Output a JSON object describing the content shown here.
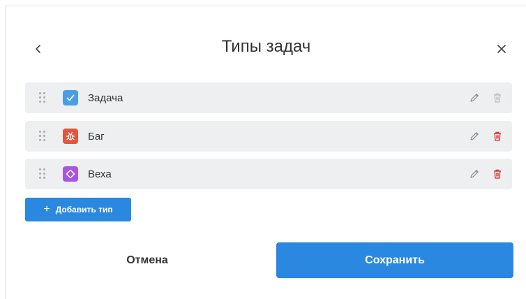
{
  "dialog": {
    "title": "Типы задач",
    "back_icon": "chevron-left-icon",
    "close_icon": "close-icon"
  },
  "types": [
    {
      "label": "Задача",
      "icon": "checkmark-icon",
      "icon_color": "#4a9ee6",
      "deletable": false
    },
    {
      "label": "Баг",
      "icon": "bug-icon",
      "icon_color": "#e2563f",
      "deletable": true
    },
    {
      "label": "Веха",
      "icon": "milestone-diamond-icon",
      "icon_color": "#a855e0",
      "deletable": true
    }
  ],
  "add_button": {
    "label": "Добавить тип",
    "icon": "plus-icon"
  },
  "footer": {
    "cancel_label": "Отмена",
    "save_label": "Сохранить"
  },
  "colors": {
    "accent": "#2b88e0",
    "delete_active": "#e03a3a",
    "delete_disabled": "#bcbcbc",
    "row_bg": "#eeeff0"
  }
}
